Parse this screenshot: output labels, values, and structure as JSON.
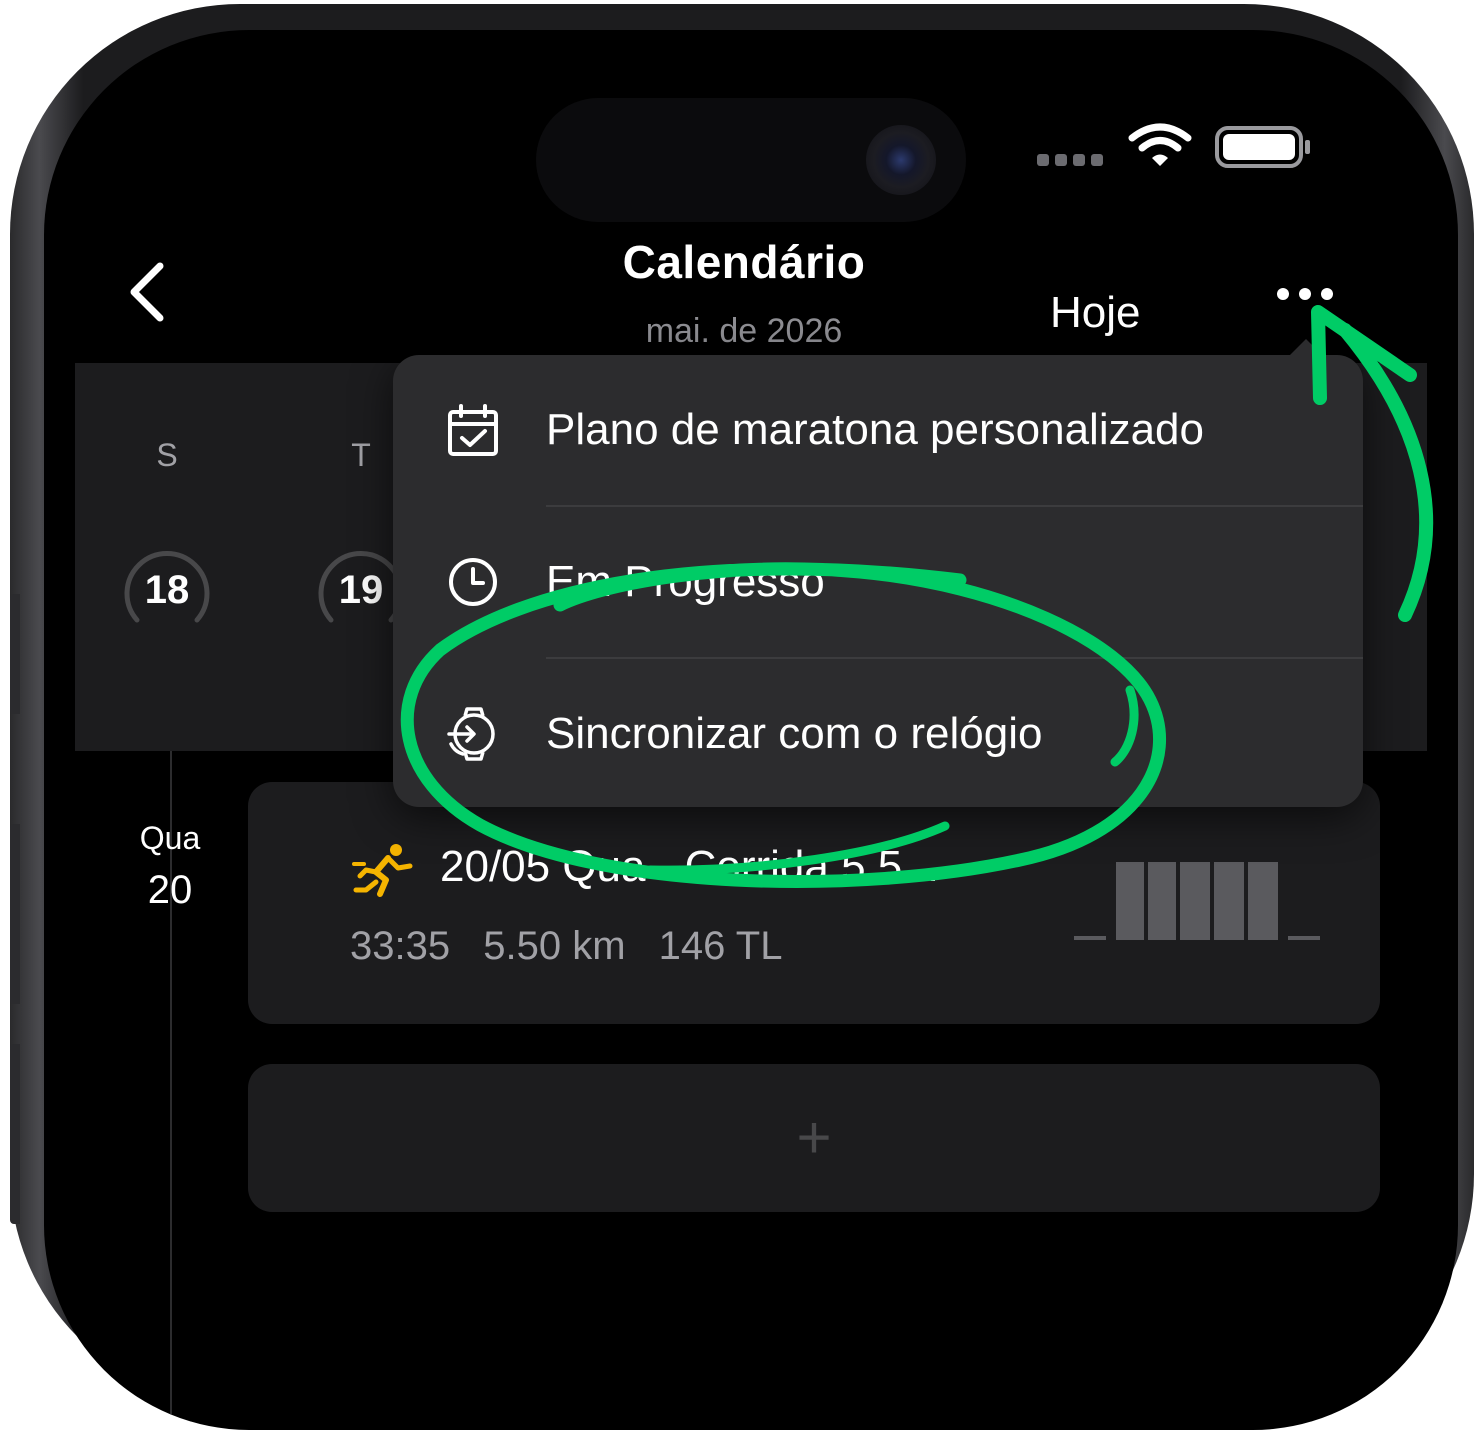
{
  "status_bar": {
    "signal_icon": "cellular-signal-icon",
    "wifi_icon": "wifi-icon",
    "battery_icon": "battery-icon"
  },
  "nav": {
    "back_icon": "chevron-left-icon",
    "title": "Calendário",
    "subtitle": "mai. de 2026",
    "today_label": "Hoje",
    "more_icon": "ellipsis-icon"
  },
  "week": {
    "days": [
      {
        "weekday": "S",
        "date": "18"
      },
      {
        "weekday": "T",
        "date": "19"
      }
    ]
  },
  "menu": {
    "items": [
      {
        "label": "Plano de maratona personalizado",
        "icon": "calendar-check-icon"
      },
      {
        "label": "Em Progresso",
        "icon": "clock-icon"
      },
      {
        "label": "Sincronizar com o relógio",
        "icon": "watch-sync-icon"
      }
    ]
  },
  "timeline": {
    "weekday": "Qua",
    "day": "20",
    "activity": {
      "icon": "running-icon",
      "title": "20/05 Qua - Corrida 5.5...",
      "duration": "33:35",
      "distance": "5.50 km",
      "load": "146 TL"
    },
    "add_symbol": "+"
  },
  "colors": {
    "background": "#000000",
    "panel": "#1c1c1e",
    "menu": "#2c2c2e",
    "annotation_green": "#00cc66",
    "run_icon": "#f5b400"
  }
}
